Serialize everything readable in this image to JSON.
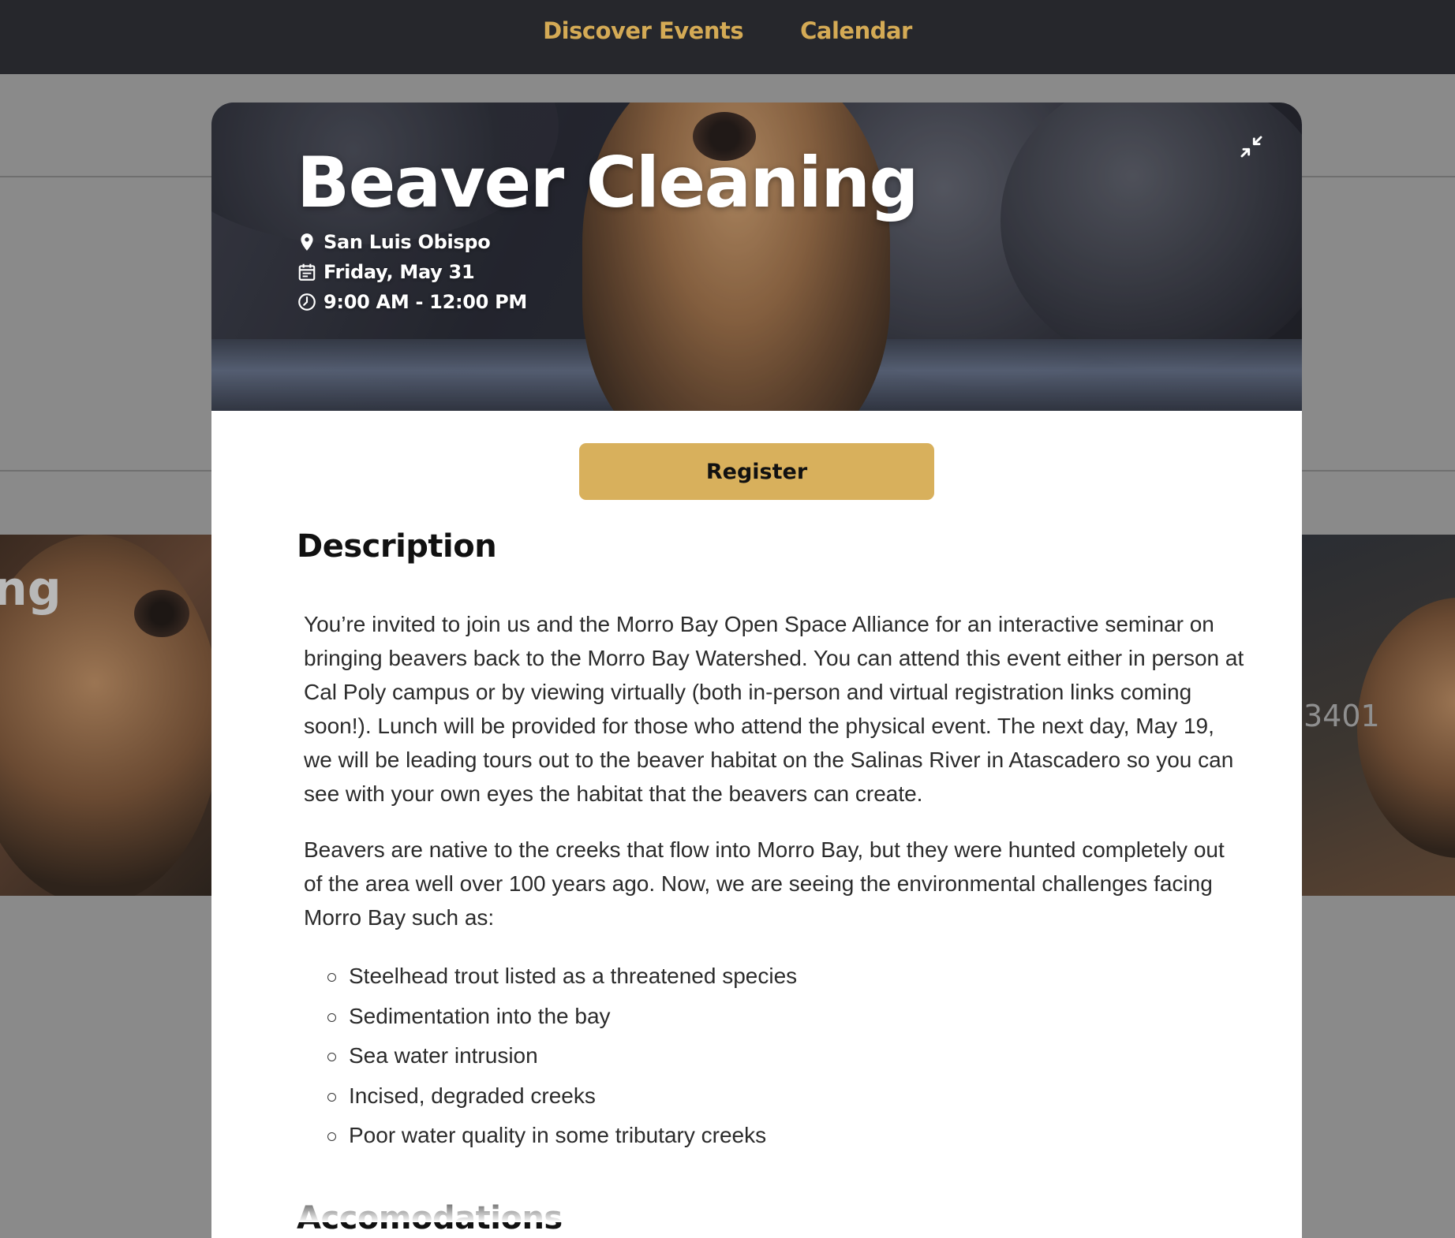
{
  "nav": {
    "items": [
      {
        "label": "Discover Events"
      },
      {
        "label": "Calendar"
      }
    ]
  },
  "background": {
    "title_fragment": "ng",
    "number_fragment": "3401"
  },
  "event": {
    "title": "Beaver Cleaning",
    "location": "San Luis Obispo",
    "date": "Friday, May 31",
    "time": "9:00 AM - 12:00 PM",
    "register_label": "Register",
    "description_heading": "Description",
    "paragraphs": [
      "You’re invited to join us and the Morro Bay Open Space Alliance for an interactive seminar on bringing beavers back to the Morro Bay Watershed. You can attend this event either in person at Cal Poly campus or by viewing virtually (both in-person and virtual registration links coming soon!). Lunch will be provided for those who attend the physical event. The next day, May 19, we will be leading tours out to the beaver habitat on the Salinas River in Atascadero so you can see with your own eyes the habitat that the beavers can create.",
      "Beavers are native to the creeks that flow into Morro Bay, but they were hunted completely out of the area well over 100 years ago. Now, we are seeing the environmental challenges facing Morro Bay such as:"
    ],
    "challenges": [
      "Steelhead trout listed as a threatened species",
      "Sedimentation into the bay",
      "Sea water intrusion",
      "Incised, degraded creeks",
      "Poor water quality in some tributary creeks"
    ],
    "accommodations_heading": "Accomodations"
  },
  "colors": {
    "nav_bg": "#26272c",
    "accent": "#d8b05c",
    "nav_link": "#d4aa55",
    "overlay": "#8a8a8a"
  },
  "icons": {
    "location": "map-pin-icon",
    "date": "calendar-icon",
    "time": "clock-icon",
    "collapse": "minimize-arrows-icon"
  }
}
